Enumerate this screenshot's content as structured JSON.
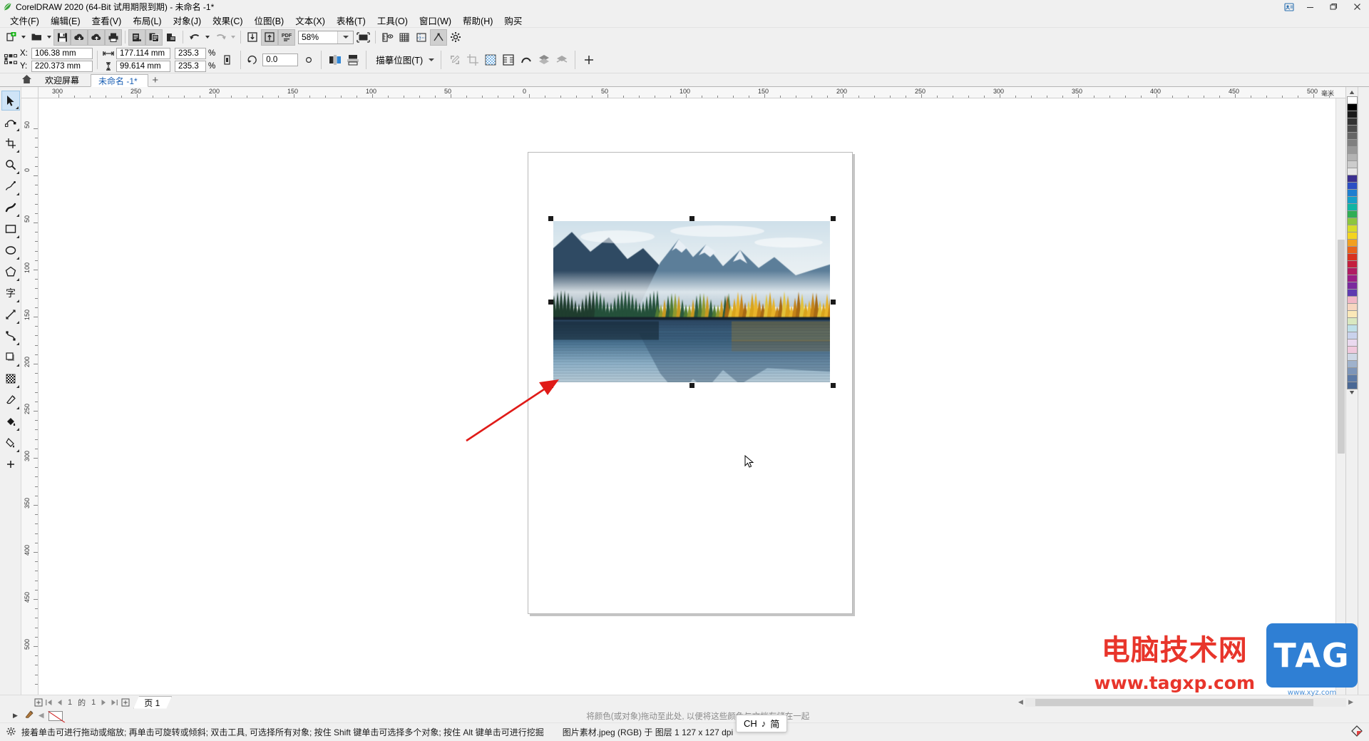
{
  "window": {
    "title": "CorelDRAW 2020 (64-Bit 试用期限到期) - 未命名 -1*",
    "logo_icon": "coreldraw-logo-icon",
    "account_icon": "account-icon",
    "minimize_icon": "minimize-icon",
    "restore_icon": "restore-icon",
    "close_icon": "close-icon"
  },
  "menubar": {
    "items": [
      {
        "label": "文件(F)",
        "name": "menu-file"
      },
      {
        "label": "编辑(E)",
        "name": "menu-edit"
      },
      {
        "label": "查看(V)",
        "name": "menu-view"
      },
      {
        "label": "布局(L)",
        "name": "menu-layout"
      },
      {
        "label": "对象(J)",
        "name": "menu-object"
      },
      {
        "label": "效果(C)",
        "name": "menu-effects"
      },
      {
        "label": "位图(B)",
        "name": "menu-bitmaps"
      },
      {
        "label": "文本(X)",
        "name": "menu-text"
      },
      {
        "label": "表格(T)",
        "name": "menu-table"
      },
      {
        "label": "工具(O)",
        "name": "menu-tools"
      },
      {
        "label": "窗口(W)",
        "name": "menu-window"
      },
      {
        "label": "帮助(H)",
        "name": "menu-help"
      },
      {
        "label": "购买",
        "name": "menu-buy"
      }
    ]
  },
  "toolbar": {
    "zoom_level": "58%",
    "buttons": [
      "new-document-icon",
      "open-document-icon",
      "save-icon",
      "cloud-download-icon",
      "cloud-upload-icon",
      "print-icon",
      "cut-icon",
      "copy-icon",
      "paste-icon",
      "undo-icon",
      "redo-icon",
      "import-icon",
      "export-icon",
      "export-pdf-icon",
      "fullscreen-preview-icon",
      "show-rulers-icon",
      "show-grid-icon",
      "show-guides-icon",
      "snap-to-icon",
      "options-icon"
    ]
  },
  "propertybar": {
    "object_position_icon": "object-position-icon",
    "x_label": "X:",
    "x_value": "106.38 mm",
    "y_label": "Y:",
    "y_value": "220.373 mm",
    "width_icon": "object-width-icon",
    "width_value": "177.114 mm",
    "height_icon": "object-height-icon",
    "height_value": "99.614 mm",
    "scale_w": "235.3",
    "scale_h": "235.3",
    "percent_w": "%",
    "percent_h": "%",
    "lock_ratio_icon": "lock-ratio-icon",
    "rotation_icon": "rotation-angle-icon",
    "rotation_value": "0.0",
    "rotation_unit_icon": "degree-icon",
    "mirror_h_icon": "mirror-horizontal-icon",
    "mirror_v_icon": "mirror-vertical-icon",
    "trace_bitmap_label": "描摹位图(T)",
    "extra_icons": [
      "edit-bitmap-icon",
      "crop-bitmap-icon",
      "transparency-icon",
      "wrap-text-icon",
      "outline-icon",
      "group-icon",
      "ungroup-icon",
      "add-icon"
    ]
  },
  "doctabs": {
    "home_icon": "home-icon",
    "tabs": [
      {
        "label": "欢迎屏幕",
        "name": "tab-welcome-screen",
        "active": false
      },
      {
        "label": "未命名 -1*",
        "name": "tab-untitled-1",
        "active": true
      }
    ],
    "new_tab_label": "+"
  },
  "toolbox": {
    "tools": [
      {
        "name": "tool-pick",
        "icon": "pick-tool-icon",
        "selected": true
      },
      {
        "name": "tool-shape",
        "icon": "shape-tool-icon",
        "selected": false
      },
      {
        "name": "tool-crop",
        "icon": "crop-tool-icon",
        "selected": false
      },
      {
        "name": "tool-zoom",
        "icon": "zoom-tool-icon",
        "selected": false
      },
      {
        "name": "tool-freehand",
        "icon": "freehand-tool-icon",
        "selected": false
      },
      {
        "name": "tool-artistic-media",
        "icon": "artistic-media-tool-icon",
        "selected": false
      },
      {
        "name": "tool-rectangle",
        "icon": "rectangle-tool-icon",
        "selected": false
      },
      {
        "name": "tool-ellipse",
        "icon": "ellipse-tool-icon",
        "selected": false
      },
      {
        "name": "tool-polygon",
        "icon": "polygon-tool-icon",
        "selected": false
      },
      {
        "name": "tool-text",
        "icon": "text-tool-icon",
        "selected": false
      },
      {
        "name": "tool-parallel-dimension",
        "icon": "dimension-tool-icon",
        "selected": false
      },
      {
        "name": "tool-connector",
        "icon": "connector-tool-icon",
        "selected": false
      },
      {
        "name": "tool-drop-shadow",
        "icon": "drop-shadow-tool-icon",
        "selected": false
      },
      {
        "name": "tool-transparency",
        "icon": "transparency-tool-icon",
        "selected": false
      },
      {
        "name": "tool-color-eyedropper",
        "icon": "eyedropper-tool-icon",
        "selected": false
      },
      {
        "name": "tool-interactive-fill",
        "icon": "fill-tool-icon",
        "selected": false
      },
      {
        "name": "tool-smart-fill",
        "icon": "smart-fill-tool-icon",
        "selected": false
      },
      {
        "name": "tool-quick-customize",
        "icon": "plus-icon",
        "selected": false
      }
    ]
  },
  "rulers": {
    "unit": "毫米",
    "h_labels": [
      "300",
      "250",
      "200",
      "150",
      "100",
      "50",
      "0",
      "50",
      "100",
      "150",
      "200",
      "250",
      "300",
      "350",
      "400",
      "450",
      "500"
    ],
    "v_labels": [
      "50",
      "0",
      "50",
      "100",
      "150",
      "200",
      "250",
      "300",
      "350",
      "400",
      "450",
      "500"
    ]
  },
  "canvas": {
    "selection": {
      "handle_count": 8,
      "object_name": "selected-bitmap"
    },
    "annotation_arrow": "red-arrow-annotation",
    "cursor_icon": "mouse-cursor-icon"
  },
  "pagebar": {
    "add_page_start_icon": "add-page-icon",
    "first_icon": "first-page-icon",
    "prev_icon": "prev-page-icon",
    "current": "1",
    "of_label": "的",
    "total": "1",
    "next_icon": "next-page-icon",
    "last_icon": "last-page-icon",
    "add_page_end_icon": "add-page-icon",
    "page_tab_label": "页 1"
  },
  "statusline2": {
    "hint": "将颜色(或对象)拖动至此处, 以便将这些颜色与文档存储在一起",
    "no_fill_swatch": "no-fill-swatch",
    "eyedropper_icon": "eyedropper-icon",
    "expand_icon": "expand-arrow-icon"
  },
  "statusbar": {
    "hint": "接着单击可进行拖动或缩放; 再单击可旋转或倾斜; 双击工具, 可选择所有对象; 按住 Shift 键单击可选择多个对象; 按住 Alt 键单击可进行挖掘",
    "document_info": "图片素材.jpeg (RGB) 于 图层 1 127 x 127 dpi",
    "ime": {
      "lang": "CH",
      "mode_icon": "music-note-icon",
      "shape": "简"
    },
    "fill_icon": "fill-color-icon",
    "outline_icon": "outline-color-icon"
  },
  "watermark": {
    "title": "电脑技术网",
    "url": "www.tagxp.com",
    "badge": "TAG",
    "sub": "www.xyz.com"
  },
  "colors": {
    "accent": "#1a5fb4",
    "selection_handle": "#1a1a1a",
    "annotation_red": "#e01b18",
    "watermark_red": "#e8352b",
    "watermark_blue": "#2f7fd4",
    "palette": [
      "#ffffff",
      "#000000",
      "#1a1a1a",
      "#333333",
      "#4d4d4d",
      "#666666",
      "#808080",
      "#999999",
      "#b3b3b3",
      "#cccccc",
      "#e6e6e6",
      "#3b2f8f",
      "#2b4fc4",
      "#1f7fd0",
      "#17a0c8",
      "#12b5a3",
      "#2fae55",
      "#8cc63f",
      "#d6dc2a",
      "#f4d41f",
      "#f2a01e",
      "#e8631c",
      "#d8321f",
      "#c41f3e",
      "#b01c63",
      "#9a1f86",
      "#7a2a9e",
      "#5e3bb0",
      "#f2b8c6",
      "#f7d6c0",
      "#fbe8b8",
      "#d9e8c0",
      "#bfe0e8",
      "#c9d2ec",
      "#ead9ef",
      "#f0c9dd",
      "#cfd8e6",
      "#9fb2cc",
      "#7d95b8",
      "#5c7aa6",
      "#4a6894"
    ]
  }
}
